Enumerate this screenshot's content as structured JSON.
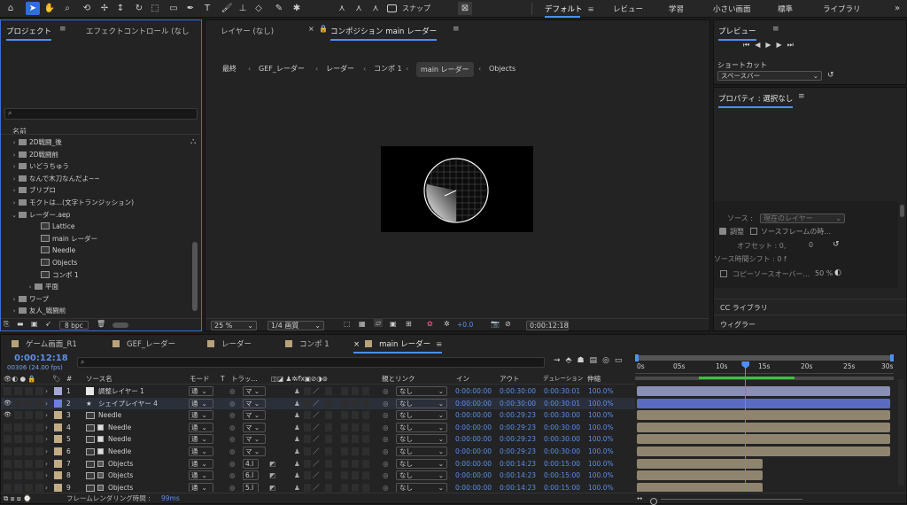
{
  "toolbar": {
    "snap_label": "スナップ",
    "workspaces": [
      {
        "label": "デフォルト",
        "active": true
      },
      {
        "label": "レビュー",
        "active": false
      },
      {
        "label": "学習",
        "active": false
      },
      {
        "label": "小さい画面",
        "active": false
      },
      {
        "label": "標準",
        "active": false
      },
      {
        "label": "ライブラリ",
        "active": false
      }
    ]
  },
  "project": {
    "tab_project": "プロジェクト",
    "tab_effect": "エフェクトコントロール (なし",
    "search_placeholder": "",
    "col_name": "名前",
    "items": [
      {
        "label": "2D戦闘_後",
        "type": "folder",
        "expanded": false,
        "indent": 0
      },
      {
        "label": "2D戦闘前",
        "type": "folder",
        "expanded": false,
        "indent": 0
      },
      {
        "label": "いどうちゅう",
        "type": "folder",
        "expanded": false,
        "indent": 0
      },
      {
        "label": "なんで木刀なんだよ~~",
        "type": "folder",
        "expanded": false,
        "indent": 0
      },
      {
        "label": "ブリプロ",
        "type": "folder",
        "expanded": false,
        "indent": 0
      },
      {
        "label": "モクトは...(文字トランジッション)",
        "type": "folder",
        "expanded": false,
        "indent": 0
      },
      {
        "label": "レーダー.aep",
        "type": "folder",
        "expanded": true,
        "indent": 0
      },
      {
        "label": "Lattice",
        "type": "comp",
        "indent": 1
      },
      {
        "label": "main レーダー",
        "type": "comp",
        "indent": 1
      },
      {
        "label": "Needle",
        "type": "comp",
        "indent": 1
      },
      {
        "label": "Objects",
        "type": "comp",
        "indent": 1
      },
      {
        "label": "コンポ 1",
        "type": "comp",
        "indent": 1
      },
      {
        "label": "平面",
        "type": "folder",
        "expanded": false,
        "indent": 1
      },
      {
        "label": "ワープ",
        "type": "folder",
        "expanded": false,
        "indent": 0
      },
      {
        "label": "友人_戦闘前",
        "type": "folder",
        "expanded": false,
        "indent": 0
      }
    ],
    "bpc": "8 bpc"
  },
  "viewer": {
    "tab_layer": "レイヤー (なし)",
    "tab_comp": "コンポジション main レーダー",
    "breadcrumbs": [
      "最終",
      "GEF_レーダー",
      "レーダー",
      "コンポ 1",
      "main レーダー",
      "Objects"
    ],
    "zoom": "25 %",
    "quality": "1/4 画質",
    "exposure": "+0.0",
    "timecode": "0:00:12:18"
  },
  "preview": {
    "title": "プレビュー",
    "shortcut_label": "ショートカット",
    "shortcut_value": "スペースバー"
  },
  "properties": {
    "title": "プロパティ : 選択なし",
    "source_label": "ソース :",
    "source_value": "現在のレイヤー",
    "adjust_label": "調整",
    "source_frame_label": "ソースフレームの時...",
    "offset_label": "オフセット : 0,",
    "offset_value2": "0",
    "time_shift": "ソース時間シフト : 0 f",
    "copy_label": "コピーソースオーバー...",
    "copy_pct": "50 %",
    "cc_library": "CC ライブラリ",
    "wiggler": "ウィグラー"
  },
  "timeline": {
    "tabs": [
      {
        "label": "ゲーム画面_R1",
        "color": "#b8a27a",
        "active": false
      },
      {
        "label": "GEF_レーダー",
        "color": "#b8a27a",
        "active": false
      },
      {
        "label": "レーダー",
        "color": "#b8a27a",
        "active": false
      },
      {
        "label": "コンポ 1",
        "color": "#b8a27a",
        "active": false
      },
      {
        "label": "main レーダー",
        "color": "#b8a27a",
        "active": true
      }
    ],
    "current_time": "0:00:12:18",
    "frame_info": "00306 (24.00 fps)",
    "headers": {
      "num": "#",
      "source": "ソース名",
      "mode": "モード",
      "t": "T",
      "track": "トラッ...",
      "parent": "親とリンク",
      "in": "イン",
      "out": "アウト",
      "duration": "デュレーション",
      "stretch": "伸縮"
    },
    "ruler": [
      "0s",
      "05s",
      "10s",
      "15s",
      "20s",
      "25s",
      "30s"
    ],
    "playhead_seconds": 12.75,
    "duration_seconds": 30,
    "layers": [
      {
        "num": "1",
        "name": "調整レイヤー 1",
        "icon": "adjust",
        "label_color": "#a7a7d6",
        "mode": "通",
        "track": "",
        "parent": "なし",
        "in": "0:00:00:00",
        "out": "0:00:30:00",
        "dur": "0:00:30:01",
        "stretch": "100.0%",
        "bar_end": 30,
        "bar_color": "#8a8fb5",
        "eye": false,
        "sel": false
      },
      {
        "num": "2",
        "name": "シェイプレイヤー 4",
        "icon": "star",
        "label_color": "#6f7de0",
        "mode": "通",
        "track": "",
        "parent": "なし",
        "in": "0:00:00:00",
        "out": "0:00:30:00",
        "dur": "0:00:30:01",
        "stretch": "100.0%",
        "bar_end": 30,
        "bar_color": "#5b6bc2",
        "eye": true,
        "sel": true
      },
      {
        "num": "3",
        "name": "Needle",
        "icon": "comp",
        "label_color": "#c2ac86",
        "mode": "通",
        "track": "",
        "parent": "なし",
        "in": "0:00:00:00",
        "out": "0:00:29:23",
        "dur": "0:00:30:00",
        "stretch": "100.0%",
        "bar_end": 30,
        "bar_color": "#8f856e",
        "eye": true,
        "sel": false
      },
      {
        "num": "4",
        "name": "Needle",
        "icon": "comp",
        "label_color": "#c2ac86",
        "mode": "通",
        "track": "",
        "parent": "なし",
        "in": "0:00:00:00",
        "out": "0:00:29:23",
        "dur": "0:00:30:00",
        "stretch": "100.0%",
        "bar_end": 30,
        "bar_color": "#8f856e",
        "eye": false,
        "sel": false
      },
      {
        "num": "5",
        "name": "Needle",
        "icon": "comp",
        "label_color": "#c2ac86",
        "mode": "通",
        "track": "",
        "parent": "なし",
        "in": "0:00:00:00",
        "out": "0:00:29:23",
        "dur": "0:00:30:00",
        "stretch": "100.0%",
        "bar_end": 30,
        "bar_color": "#8f856e",
        "eye": false,
        "sel": false
      },
      {
        "num": "6",
        "name": "Needle",
        "icon": "comp",
        "label_color": "#c2ac86",
        "mode": "通",
        "track": "",
        "parent": "なし",
        "in": "0:00:00:00",
        "out": "0:00:29:23",
        "dur": "0:00:30:00",
        "stretch": "100.0%",
        "bar_end": 30,
        "bar_color": "#8f856e",
        "eye": false,
        "sel": false
      },
      {
        "num": "7",
        "name": "Objects",
        "icon": "comp",
        "label_color": "#c2ac86",
        "mode": "通",
        "track": "4.l",
        "parent": "なし",
        "in": "0:00:00:00",
        "out": "0:00:14:23",
        "dur": "0:00:15:00",
        "stretch": "100.0%",
        "bar_end": 15,
        "bar_color": "#8f856e",
        "eye": false,
        "sel": false
      },
      {
        "num": "8",
        "name": "Objects",
        "icon": "comp",
        "label_color": "#c2ac86",
        "mode": "通",
        "track": "6.l",
        "parent": "なし",
        "in": "0:00:00:00",
        "out": "0:00:14:23",
        "dur": "0:00:15:00",
        "stretch": "100.0%",
        "bar_end": 15,
        "bar_color": "#8f856e",
        "eye": false,
        "sel": false
      },
      {
        "num": "9",
        "name": "Objects",
        "icon": "comp",
        "label_color": "#c2ac86",
        "mode": "通",
        "track": "5.l",
        "parent": "なし",
        "in": "0:00:00:00",
        "out": "0:00:14:23",
        "dur": "0:00:15:00",
        "stretch": "100.0%",
        "bar_end": 15,
        "bar_color": "#8f856e",
        "eye": false,
        "sel": false
      }
    ],
    "render_time_label": "フレームレンダリング時間 :",
    "render_time_value": "99ms"
  },
  "colors": {
    "accent": "#4d8ff5",
    "panel": "#232323",
    "bg": "#1c1c1c"
  }
}
